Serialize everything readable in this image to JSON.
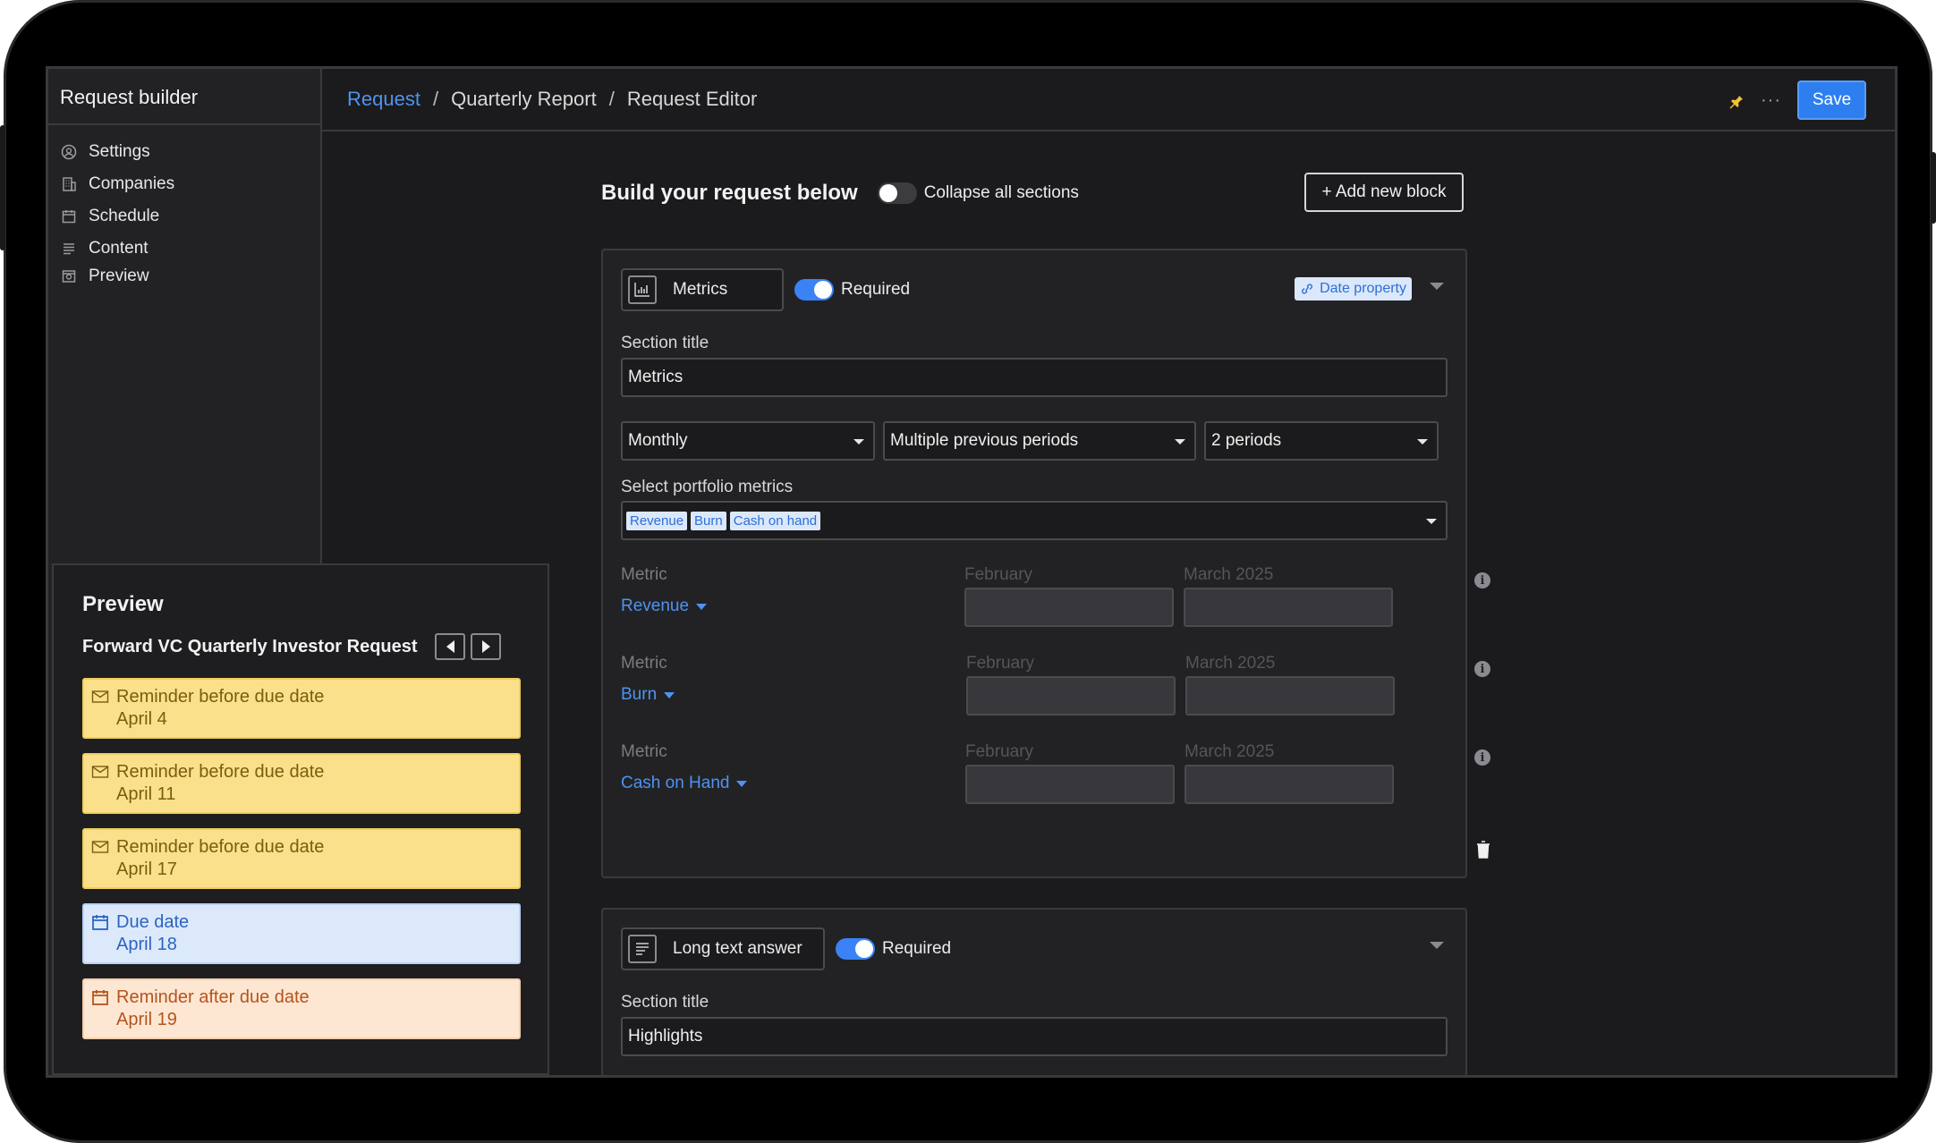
{
  "sidebar": {
    "title": "Request builder",
    "items": [
      {
        "label": "Settings",
        "icon": "settings-icon"
      },
      {
        "label": "Companies",
        "icon": "building-icon"
      },
      {
        "label": "Schedule",
        "icon": "calendar-icon"
      },
      {
        "label": "Content",
        "icon": "list-icon"
      },
      {
        "label": "Preview",
        "icon": "preview-icon"
      }
    ]
  },
  "breadcrumb": {
    "items": [
      "Request",
      "Quarterly Report",
      "Request Editor"
    ],
    "separator": "/"
  },
  "toolbar": {
    "more": "···",
    "save_label": "Save"
  },
  "main": {
    "title": "Build your request below",
    "collapse_label": "Collapse all sections",
    "add_block_label": "+ Add new block"
  },
  "metrics_block": {
    "type_label": "Metrics",
    "required_label": "Required",
    "date_property_label": "Date property",
    "section_title_label": "Section title",
    "section_title_value": "Metrics",
    "frequency": "Monthly",
    "period_mode": "Multiple previous periods",
    "period_count": "2 periods",
    "portfolio_label": "Select portfolio metrics",
    "chips": [
      "Revenue",
      "Burn",
      "Cash on hand"
    ],
    "rows": [
      {
        "label": "Metric",
        "name": "Revenue",
        "col1": "February",
        "col2": "March 2025"
      },
      {
        "label": "Metric",
        "name": "Burn",
        "col1": "February",
        "col2": "March 2025"
      },
      {
        "label": "Metric",
        "name": "Cash on Hand",
        "col1": "February",
        "col2": "March 2025"
      }
    ]
  },
  "text_block": {
    "type_label": "Long text answer",
    "required_label": "Required",
    "section_title_label": "Section title",
    "section_title_value": "Highlights"
  },
  "preview": {
    "title": "Preview",
    "subtitle": "Forward VC Quarterly Investor Request",
    "events": [
      {
        "title": "Reminder before due date",
        "date": "April 4",
        "kind": "reminder"
      },
      {
        "title": "Reminder before due date",
        "date": "April 11",
        "kind": "reminder"
      },
      {
        "title": "Reminder before due date",
        "date": "April 17",
        "kind": "reminder"
      },
      {
        "title": "Due date",
        "date": "April 18",
        "kind": "due"
      },
      {
        "title": "Reminder after due date",
        "date": "April 19",
        "kind": "after"
      }
    ]
  },
  "colors": {
    "accent": "#2d7ff0",
    "background": "#1b1b1d",
    "reminder": "#fbe08b",
    "due": "#dce9fb",
    "after": "#fde7d2"
  }
}
